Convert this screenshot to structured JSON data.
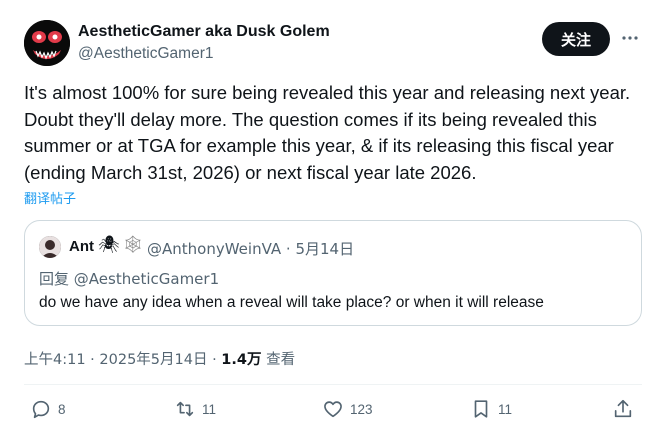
{
  "author": {
    "name": "AestheticGamer aka Dusk Golem",
    "handle": "@AestheticGamer1",
    "avatar_icon": "red-eyed-monster-avatar"
  },
  "follow_label": "关注",
  "more_icon": "more-dots-icon",
  "tweet_text": "It's almost 100% for sure being revealed this year and releasing next year.\nDoubt they'll delay more. The question comes if its being revealed this\nsummer or at TGA for example this year, & if its releasing this fiscal year\n(ending March 31st, 2026) or next fiscal year late 2026.",
  "translate_label": "翻译帖子",
  "quote": {
    "name": "Ant",
    "emoji_spider": "🕷",
    "emoji_web": "🕸",
    "handle_date": "@AnthonyWeinVA · 5月14日",
    "reply_prefix": "回复",
    "reply_to": "@AestheticGamer1",
    "text": "do we have any idea when a reveal will take place? or when it will release"
  },
  "meta": {
    "time_date": "上午4:11 · 2025年5月14日 · ",
    "views": "1.4万",
    "views_label": " 查看"
  },
  "actions": {
    "replies": "8",
    "reposts": "11",
    "likes": "123",
    "bookmarks": "11"
  },
  "colors": {
    "accent": "#1d9bf0",
    "text": "#0f1419",
    "secondary": "#536471"
  }
}
